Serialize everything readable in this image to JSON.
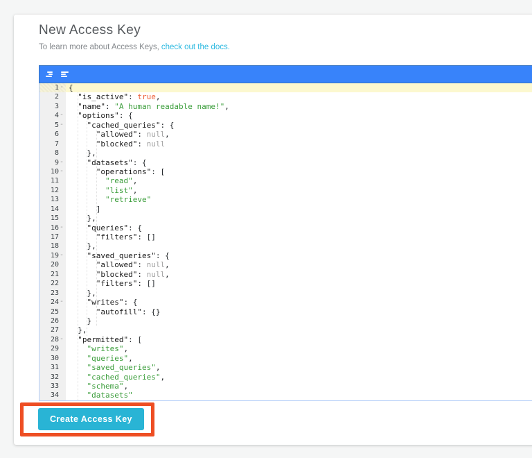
{
  "page": {
    "title": "New Access Key",
    "subtitle_prefix": "To learn more about Access Keys,",
    "subtitle_link": "check out the docs."
  },
  "editor": {
    "toolbar": {
      "background": "#3883fa",
      "icons": [
        {
          "name": "format-json-icon"
        },
        {
          "name": "compact-json-icon"
        }
      ]
    },
    "active_line": 1,
    "fold_lines": [
      1,
      4,
      5,
      9,
      10,
      16,
      19,
      24,
      28
    ],
    "colors": {
      "key": "#1a1a1a",
      "string": "#3a9d3a",
      "boolean": "#ee5d36",
      "null": "#a2a2a2",
      "active_line_bg": "#fcf8cf"
    },
    "lines": [
      "{",
      "  \"is_active\": true,",
      "  \"name\": \"A human readable name!\",",
      "  \"options\": {",
      "    \"cached_queries\": {",
      "      \"allowed\": null,",
      "      \"blocked\": null",
      "    },",
      "    \"datasets\": {",
      "      \"operations\": [",
      "        \"read\",",
      "        \"list\",",
      "        \"retrieve\"",
      "      ]",
      "    },",
      "    \"queries\": {",
      "      \"filters\": []",
      "    },",
      "    \"saved_queries\": {",
      "      \"allowed\": null,",
      "      \"blocked\": null,",
      "      \"filters\": []",
      "    },",
      "    \"writes\": {",
      "      \"autofill\": {}",
      "    }",
      "  },",
      "  \"permitted\": [",
      "    \"writes\",",
      "    \"queries\",",
      "    \"saved_queries\",",
      "    \"cached_queries\",",
      "    \"schema\",",
      "    \"datasets\""
    ]
  },
  "button": {
    "label": "Create Access Key",
    "background": "#29b4d5"
  },
  "annotation": {
    "border_color": "#ee4e23"
  }
}
